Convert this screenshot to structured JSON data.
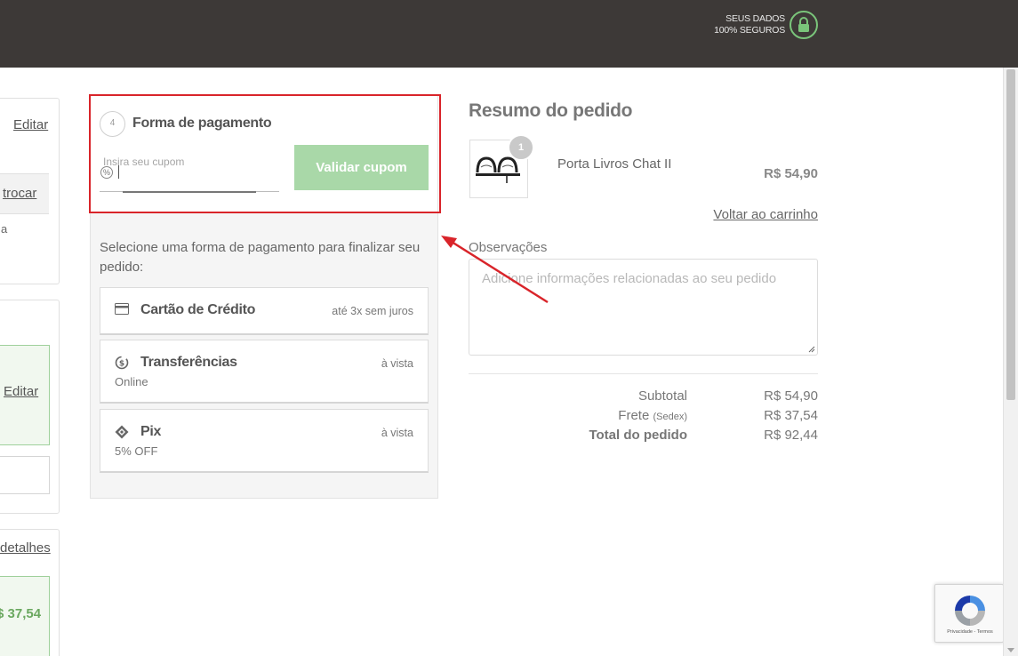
{
  "header": {
    "secure_line1": "SEUS DADOS",
    "secure_line2": "100% SEGUROS",
    "lock_icon": "lock-icon",
    "bg_color": "#3d3937",
    "accent_color": "#7ac47a"
  },
  "left_panels": {
    "edit_label_1": "Editar",
    "change_label": "trocar",
    "partial_text": "a",
    "edit_label_2": "Editar",
    "details_label": "detalhes",
    "shipping_price_partial": "$ 37,54"
  },
  "payment": {
    "step_number": "4",
    "title": "Forma de pagamento",
    "coupon_placeholder": "Insira seu cupom",
    "coupon_icon": "percent-icon",
    "validate_button": "Validar cupom",
    "intro": "Selecione uma forma de pagamento para finalizar seu pedido:",
    "options": [
      {
        "name": "Cartão de Crédito",
        "sub": "",
        "condition": "até 3x sem juros",
        "icon": "credit-card-icon"
      },
      {
        "name": "Transferências",
        "sub": "Online",
        "condition": "à vista",
        "icon": "transfer-icon"
      },
      {
        "name": "Pix",
        "sub": "5% OFF",
        "condition": "à vista",
        "icon": "pix-icon"
      }
    ]
  },
  "summary": {
    "title": "Resumo do pedido",
    "item": {
      "quantity": "1",
      "name": "Porta Livros Chat II",
      "price": "R$ 54,90"
    },
    "back_to_cart": "Voltar ao carrinho",
    "observations_label": "Observações",
    "observations_placeholder": "Adicione informações relacionadas ao seu pedido",
    "subtotal_label": "Subtotal",
    "subtotal_value": "R$ 54,90",
    "shipping_label": "Frete",
    "shipping_method": "(Sedex)",
    "shipping_value": "R$ 37,54",
    "total_label": "Total do pedido",
    "total_value": "R$ 92,44"
  },
  "recaptcha": {
    "text": "Privacidade - Termos"
  },
  "colors": {
    "highlight": "#d9242a",
    "button_green": "#a9d8a8"
  }
}
